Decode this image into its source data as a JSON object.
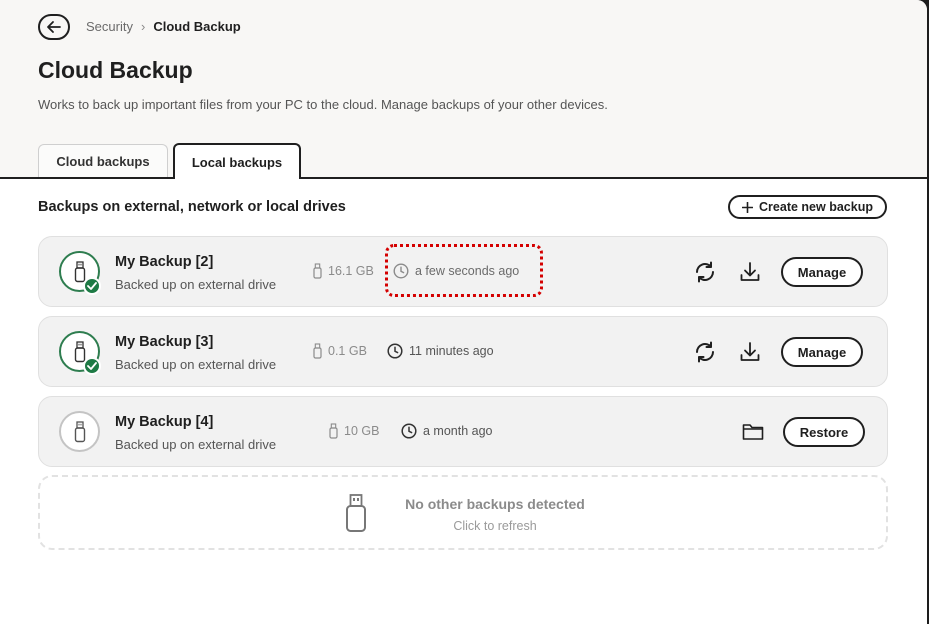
{
  "header": {
    "breadcrumb": {
      "parent": "Security",
      "separator": "›",
      "current": "Cloud Backup"
    },
    "title": "Cloud Backup",
    "description": "Works to back up important files from your PC to the cloud. Manage backups of your other devices."
  },
  "tabs": [
    {
      "label": "Cloud backups",
      "active": false
    },
    {
      "label": "Local backups",
      "active": true
    }
  ],
  "section": {
    "title": "Backups on external, network or local drives",
    "create_label": "Create new backup"
  },
  "backups": [
    {
      "name": "My Backup [2]",
      "status": "Backed up on external drive",
      "size": "16.1 GB",
      "time": "a few seconds ago",
      "action": "Manage",
      "healthy": true
    },
    {
      "name": "My Backup [3]",
      "status": "Backed up on external drive",
      "size": "0.1 GB",
      "time": "11 minutes ago",
      "action": "Manage",
      "healthy": true
    },
    {
      "name": "My Backup [4]",
      "status": "Backed up on external drive",
      "size": "10 GB",
      "time": "a month ago",
      "action": "Restore",
      "healthy": false
    }
  ],
  "empty": {
    "title": "No other backups detected",
    "subtitle": "Click to refresh"
  },
  "colors": {
    "accent_green": "#1e7a45",
    "highlight_red": "#d40000",
    "text_dark": "#1f1f1f"
  }
}
